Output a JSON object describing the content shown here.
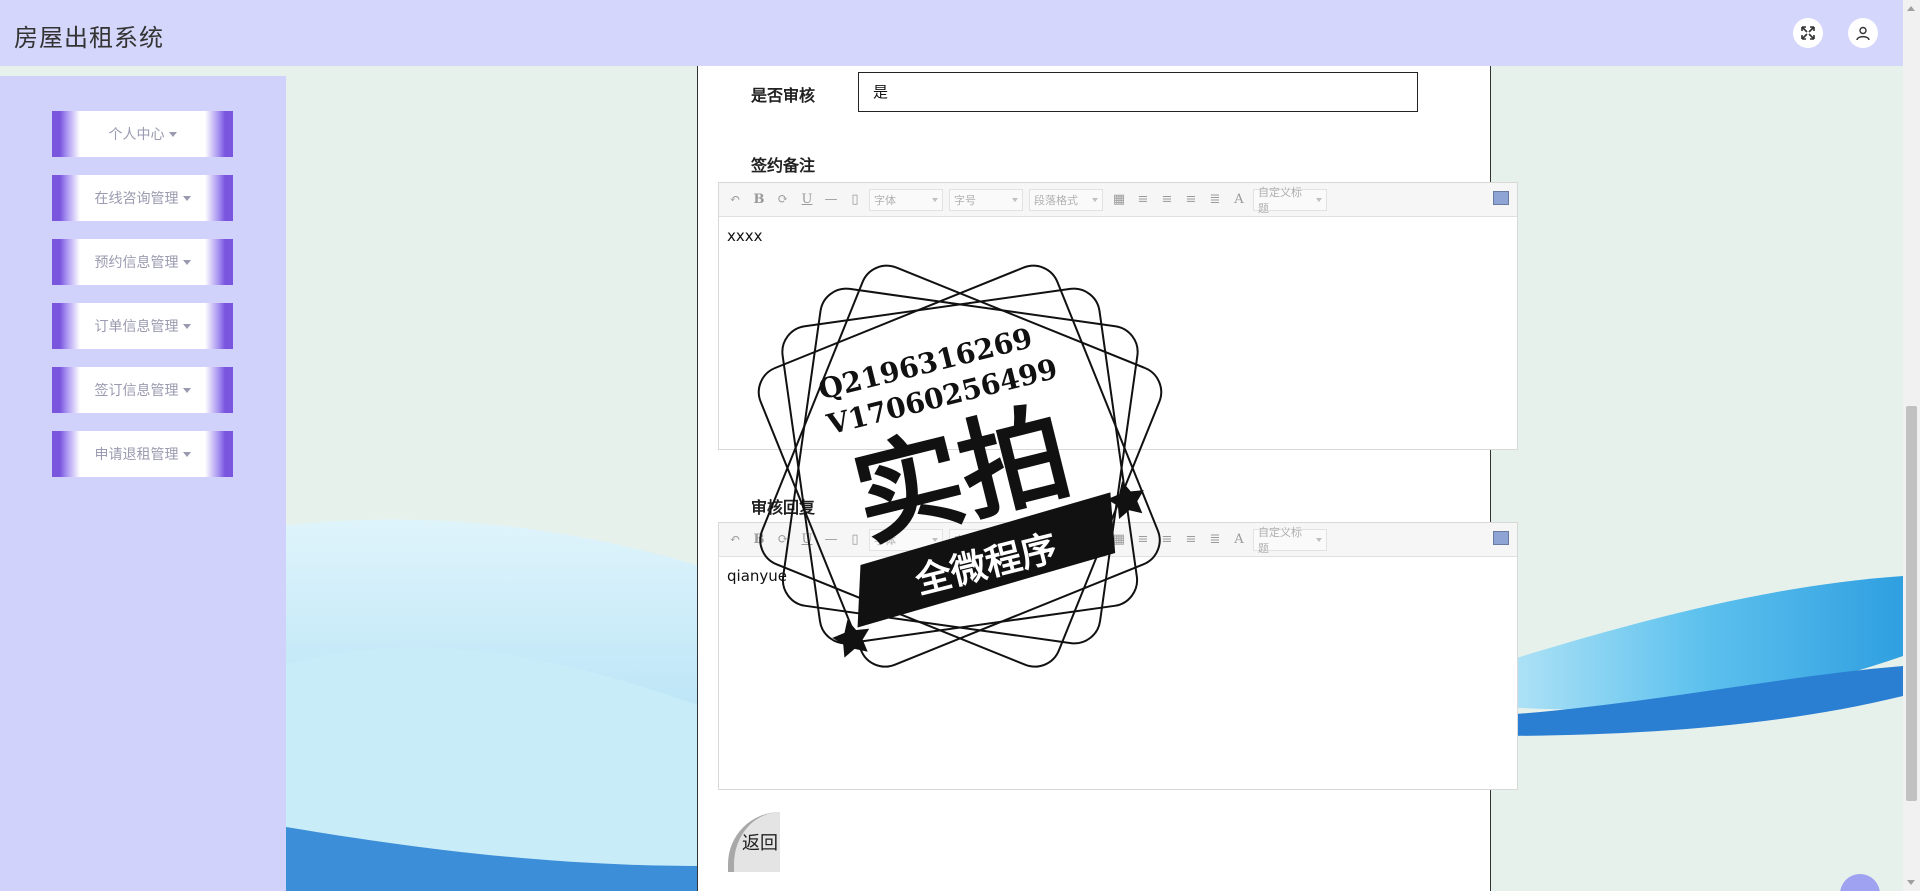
{
  "app": {
    "title": "房屋出租系统"
  },
  "header": {
    "fullscreen_icon": "expand-icon",
    "user_icon": "user-icon"
  },
  "sidebar": {
    "items": [
      {
        "label": "个人中心"
      },
      {
        "label": "在线咨询管理"
      },
      {
        "label": "预约信息管理"
      },
      {
        "label": "订单信息管理"
      },
      {
        "label": "签订信息管理"
      },
      {
        "label": "申请退租管理"
      }
    ]
  },
  "form": {
    "audit_label": "是否审核",
    "audit_value": "是",
    "remark_label": "签约备注",
    "remark_value": "xxxx",
    "reply_label": "审核回复",
    "reply_value": "qianyue",
    "back_label": "返回"
  },
  "editor_toolbar": {
    "font_select": "字体",
    "size_select": "字号",
    "para_select": "段落格式",
    "title_select": "自定义标题",
    "color_letter": "A"
  },
  "watermark": {
    "line1": "Q2196316269",
    "line2": "V17060256499",
    "main": "实拍",
    "banner": "全微程序"
  },
  "colors": {
    "header": "#d4d6fb",
    "sidebar": "#d1d2fb",
    "menu_accent": "#7a55dd"
  }
}
